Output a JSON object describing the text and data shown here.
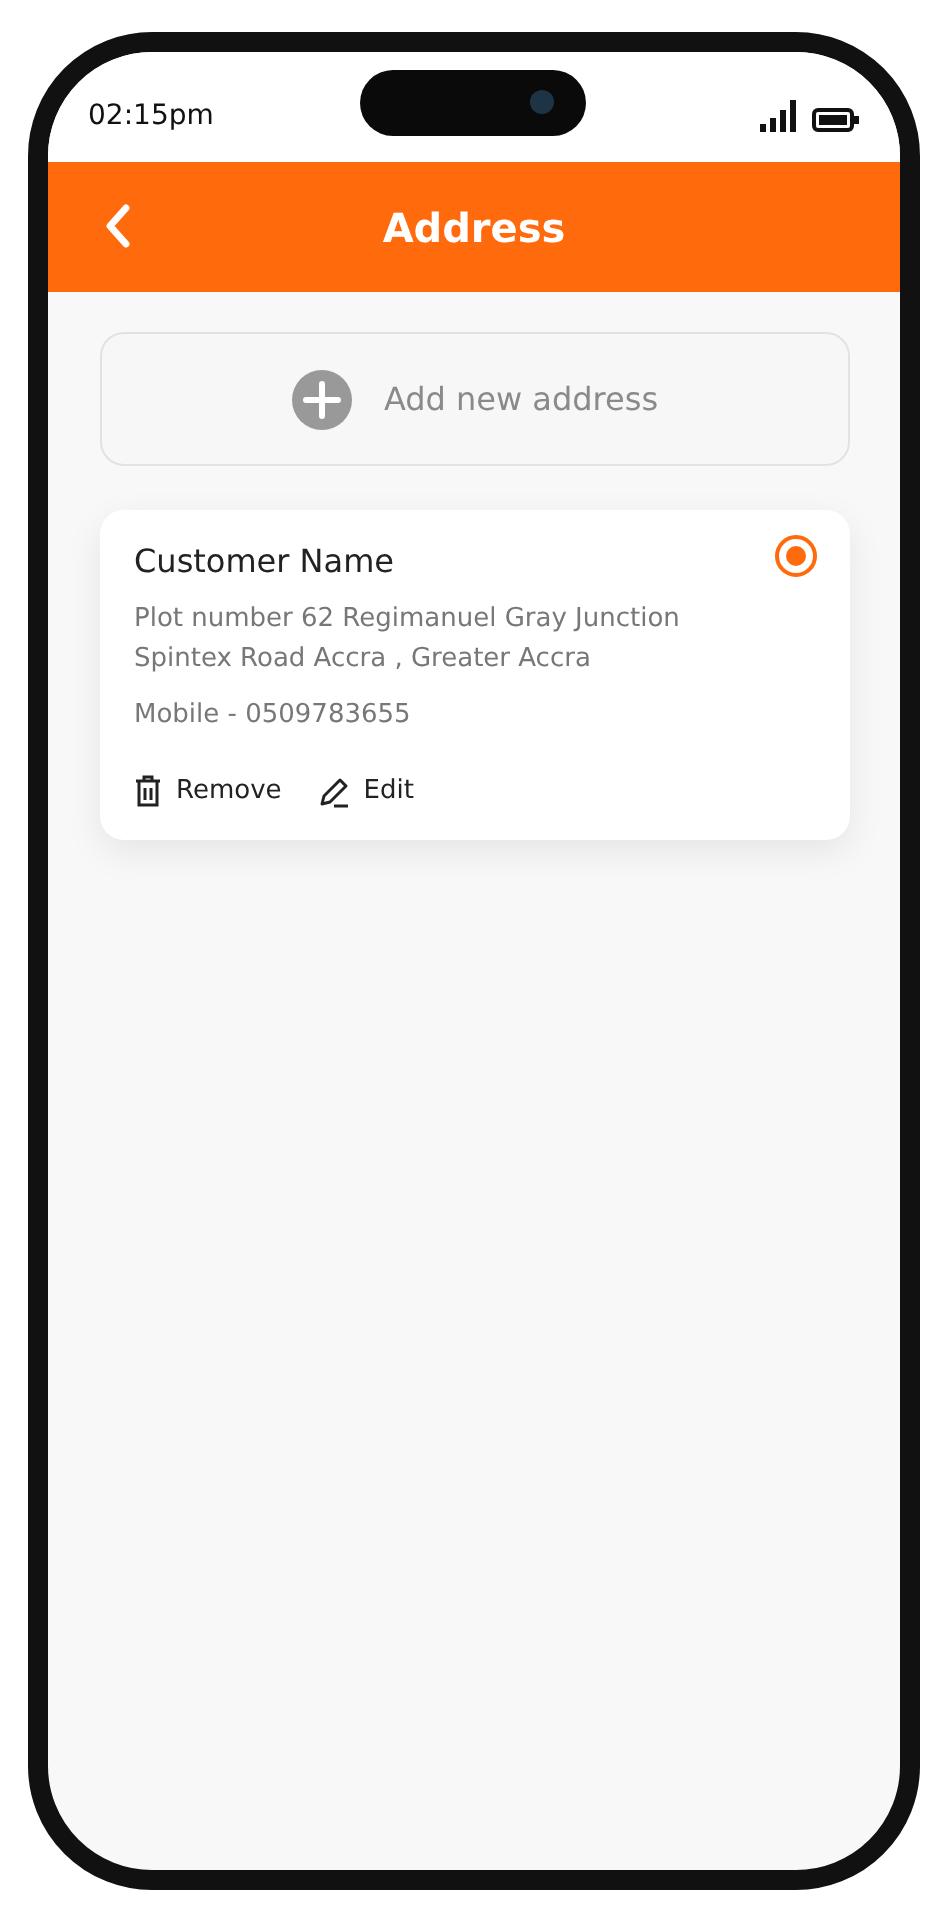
{
  "status_bar": {
    "time": "02:15pm"
  },
  "header": {
    "title": "Address"
  },
  "add_button": {
    "label": "Add new address"
  },
  "addresses": [
    {
      "name": "Customer Name",
      "address_lines": [
        "Plot number 62 Regimanuel Gray Junction",
        "Spintex Road Accra , Greater Accra"
      ],
      "mobile": "Mobile - 0509783655",
      "selected": true,
      "actions": [
        {
          "kind": "remove",
          "label": "Remove"
        },
        {
          "kind": "edit",
          "label": "Edit"
        }
      ]
    }
  ]
}
